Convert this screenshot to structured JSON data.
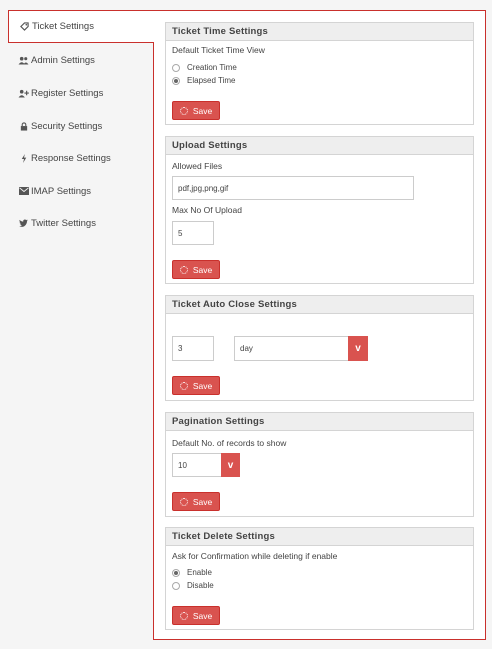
{
  "sidebar": {
    "items": [
      {
        "label": "Ticket Settings",
        "icon": "tag-icon"
      },
      {
        "label": "Admin Settings",
        "icon": "users-icon"
      },
      {
        "label": "Register Settings",
        "icon": "user-plus-icon"
      },
      {
        "label": "Security Settings",
        "icon": "lock-icon"
      },
      {
        "label": "Response Settings",
        "icon": "bolt-icon"
      },
      {
        "label": "IMAP Settings",
        "icon": "envelope-icon"
      },
      {
        "label": "Twitter Settings",
        "icon": "twitter-icon"
      }
    ]
  },
  "ticket_time": {
    "title": "Ticket Time Settings",
    "label": "Default Ticket Time View",
    "options": [
      "Creation Time",
      "Elapsed Time"
    ],
    "selected": "Elapsed Time",
    "save": "Save"
  },
  "upload": {
    "title": "Upload Settings",
    "allowed_label": "Allowed Files",
    "allowed_value": "pdf,jpg,png,gif",
    "max_label": "Max No Of Upload",
    "max_value": "5",
    "save": "Save"
  },
  "auto_close": {
    "title": "Ticket Auto Close Settings",
    "number_value": "3",
    "unit_value": "day",
    "save": "Save"
  },
  "pagination": {
    "title": "Pagination Settings",
    "label": "Default No. of records to show",
    "value": "10",
    "save": "Save"
  },
  "delete": {
    "title": "Ticket Delete Settings",
    "label": "Ask for Confirmation while deleting if enable",
    "options": [
      "Enable",
      "Disable"
    ],
    "selected": "Enable",
    "save": "Save"
  },
  "colors": {
    "accent": "#d9534f",
    "border_accent": "#c9302c"
  }
}
